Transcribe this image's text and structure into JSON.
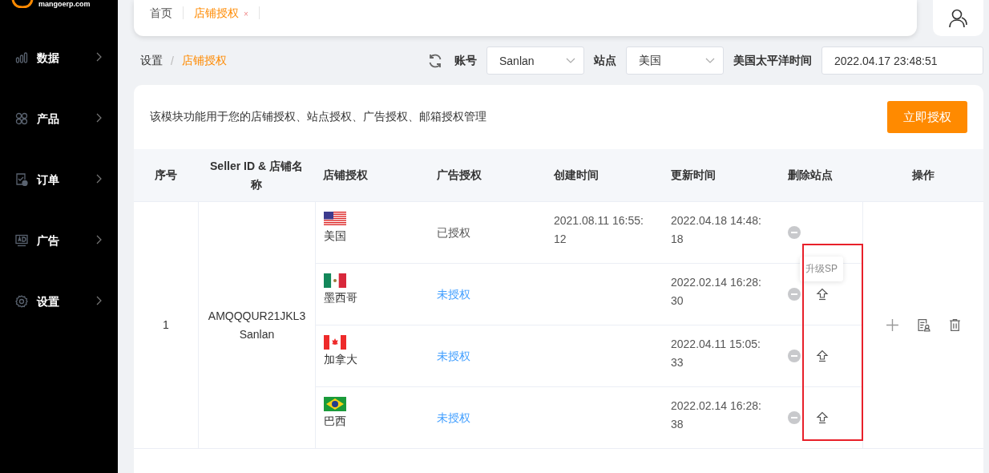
{
  "sidebar": {
    "logo_text": "mangoerp.com",
    "items": [
      {
        "kind": "chart",
        "label": "数据",
        "expanded": false
      },
      {
        "kind": "grid",
        "label": "产品",
        "expanded": false
      },
      {
        "kind": "order",
        "label": "订单",
        "expanded": false
      },
      {
        "kind": "ad",
        "label": "广告",
        "expanded": false
      },
      {
        "kind": "gear",
        "label": "设置",
        "expanded": false
      }
    ]
  },
  "tabs": [
    {
      "label": "首页",
      "selected": false
    },
    {
      "label": "店铺授权",
      "selected": true,
      "close": "×"
    }
  ],
  "breadcrumb": {
    "items": [
      {
        "label": "设置",
        "selected": false
      },
      {
        "label": "店铺授权",
        "selected": true
      }
    ],
    "separator": "/"
  },
  "filters": {
    "account_label": "账号",
    "account_value": "Sanlan",
    "site_label": "站点",
    "site_value": "美国",
    "time_label": "美国太平洋时间",
    "time_value": "2022.04.17 23:48:51"
  },
  "card": {
    "description": "该模块功能用于您的店铺授权、站点授权、广告授权、邮箱授权管理",
    "button": "立即授权"
  },
  "table": {
    "columns": [
      "序号",
      "Seller ID & 店铺名称",
      "店铺授权",
      "广告授权",
      "创建时间",
      "更新时间",
      "删除站点",
      "操作"
    ],
    "rows": [
      {
        "index": "1",
        "seller_id": "AMQQQUR21JKL3",
        "store_name": "Sanlan",
        "sites": [
          {
            "kind": "us",
            "name": "美国",
            "ad_auth": "已授权",
            "authorized": true,
            "created": "2021.08.11 16:55:12",
            "updated": "2022.04.18 14:48:18",
            "upgradable": false
          },
          {
            "kind": "mx",
            "name": "墨西哥",
            "ad_auth": "未授权",
            "authorized": false,
            "updated": "2022.02.14 16:28:30",
            "upgradable": true
          },
          {
            "kind": "ca",
            "name": "加拿大",
            "ad_auth": "未授权",
            "authorized": false,
            "updated": "2022.04.11 15:05:33",
            "upgradable": true
          },
          {
            "kind": "br",
            "name": "巴西",
            "ad_auth": "未授权",
            "authorized": false,
            "updated": "2022.02.14 16:28:38",
            "upgradable": true
          }
        ]
      }
    ]
  },
  "tooltip": {
    "text": "升级SP"
  }
}
